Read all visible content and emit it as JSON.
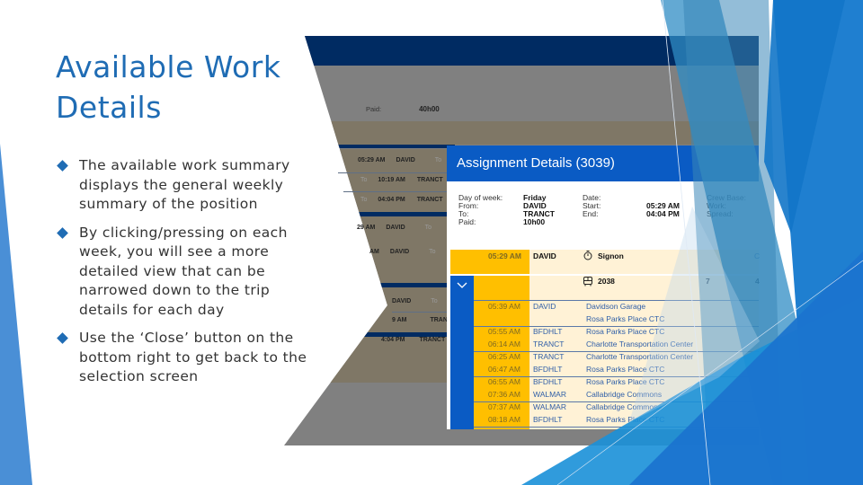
{
  "slide": {
    "title_line1": "Available Work",
    "title_line2": "Details",
    "bullets": [
      "The available work summary displays the general weekly summary of the position",
      "By clicking/pressing on each week, you will see a more detailed view that can be narrowed down to the trip details for each day",
      "Use the ‘Close’ button on the bottom right to get back to the selection screen"
    ]
  },
  "background_screen": {
    "paid_label": "Paid:",
    "paid_value": "40h00",
    "rows": [
      {
        "c1": "05:29 AM",
        "c2": "DAVID",
        "c3": "To"
      },
      {
        "c0": "To",
        "c1": "10:19 AM",
        "c2": "TRANCT"
      },
      {
        "c0": "To",
        "c1": "04:04 PM",
        "c2": "TRANCT"
      },
      {
        "c1": "29 AM",
        "c2": "DAVID",
        "c3": "To"
      },
      {
        "c1": "AM",
        "c2": "DAVID",
        "c3": "To"
      },
      {
        "c2": "DAVID",
        "c3": "To"
      },
      {
        "c1": "9 AM",
        "c2": "TRANCT"
      },
      {
        "c1": "4:04 PM",
        "c2": "TRANCT"
      }
    ]
  },
  "dialog": {
    "title": "Assignment Details (3039)",
    "info": {
      "day_label": "Day of week:",
      "day_value": "Friday",
      "from_label": "From:",
      "from_value": "DAVID",
      "to_label": "To:",
      "to_value": "TRANCT",
      "paid_label": "Paid:",
      "paid_value": "10h00",
      "date_label": "Date:",
      "date_value": "",
      "start_label": "Start:",
      "start_value": "05:29 AM",
      "end_label": "End:",
      "end_value": "04:04 PM",
      "crew_label": "Crew Base:",
      "work_label": "Work:",
      "spread_label": "Spread:"
    },
    "signon": {
      "time": "05:29 AM",
      "place": "DAVID",
      "icon": "stopwatch-icon",
      "label": "Signon",
      "extra": "C"
    },
    "trip": {
      "icon": "bus-icon",
      "number": "2038",
      "col1": "7",
      "col2": "4",
      "expand_icon": "chevron-down-icon"
    },
    "stops": [
      {
        "time": "05:39 AM",
        "code": "DAVID",
        "name": "Davidson Garage",
        "name2": "Rosa Parks Place CTC"
      },
      {
        "time": "05:55 AM",
        "code": "BFDHLT",
        "name": "Rosa Parks Place CTC"
      },
      {
        "time": "06:14 AM",
        "code": "TRANCT",
        "name": "Charlotte Transportation Center"
      },
      {
        "time": "06:25 AM",
        "code": "TRANCT",
        "name": "Charlotte Transportation Center"
      },
      {
        "time": "06:47 AM",
        "code": "BFDHLT",
        "name": "Rosa Parks Place CTC"
      },
      {
        "time": "06:55 AM",
        "code": "BFDHLT",
        "name": "Rosa Parks Place CTC"
      },
      {
        "time": "07:36 AM",
        "code": "WALMAR",
        "name": "Callabridge Commons"
      },
      {
        "time": "07:37 AM",
        "code": "WALMAR",
        "name": "Callabridge Commons"
      },
      {
        "time": "08:18 AM",
        "code": "BFDHLT",
        "name": "Rosa Parks Place CTC"
      }
    ]
  },
  "colors": {
    "title_blue": "#1f6cb4",
    "header_navy": "#002b62",
    "dialog_header": "#0a5bc4",
    "time_yellow": "#ffbf00",
    "row_cream": "#fff2d6",
    "stop_text": "#2f5fa8"
  }
}
